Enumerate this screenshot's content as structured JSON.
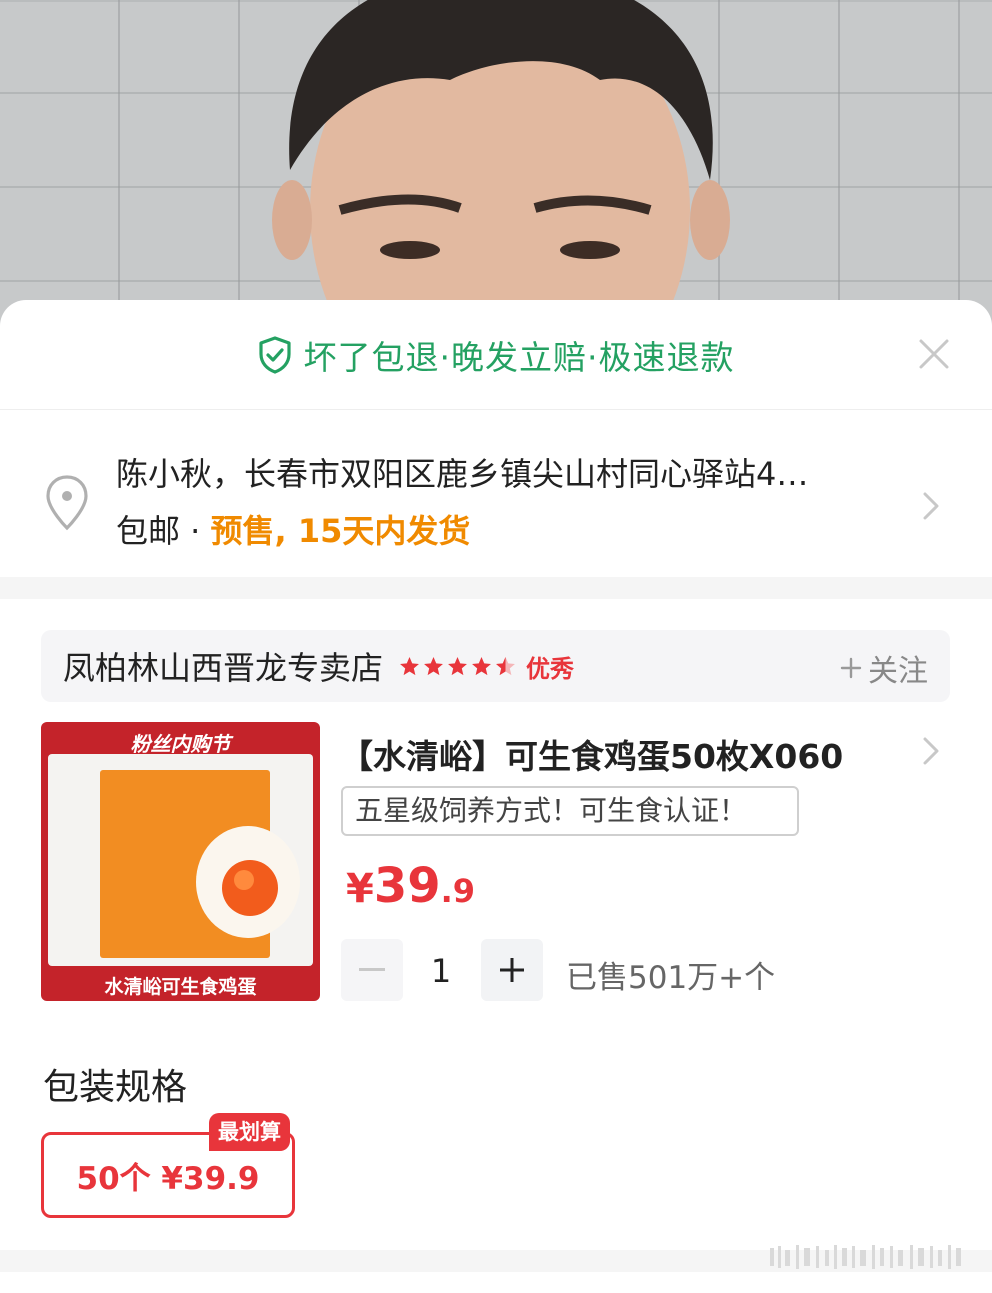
{
  "guarantee": {
    "text": "坏了包退·晚发立赔·极速退款",
    "icon": "shield-check-icon",
    "color": "#24a162"
  },
  "address": {
    "line1": "陈小秋，长春市双阳区鹿乡镇尖山村同心驿站4…",
    "shipping": "包邮 · ",
    "presale": "预售, 15天内发货",
    "presale_color": "#f08a00"
  },
  "store": {
    "name": "凤柏林山西晋龙专卖店",
    "rating_stars": 4.5,
    "rating_label": "优秀",
    "follow_label": "关注"
  },
  "product": {
    "image_top_text": "粉丝内购节",
    "image_bottom_text": "水清峪可生食鸡蛋",
    "title": "【水清峪】可生食鸡蛋50枚X060",
    "tag": "五星级饲养方式！可生食认证！",
    "price_symbol": "¥",
    "price_int": "39",
    "price_dec": ".9",
    "quantity": "1",
    "sold": "已售501万+个",
    "accent": "#e8353b"
  },
  "spec": {
    "title": "包装规格",
    "option_label": "50个 ¥39.9",
    "badge": "最划算"
  }
}
